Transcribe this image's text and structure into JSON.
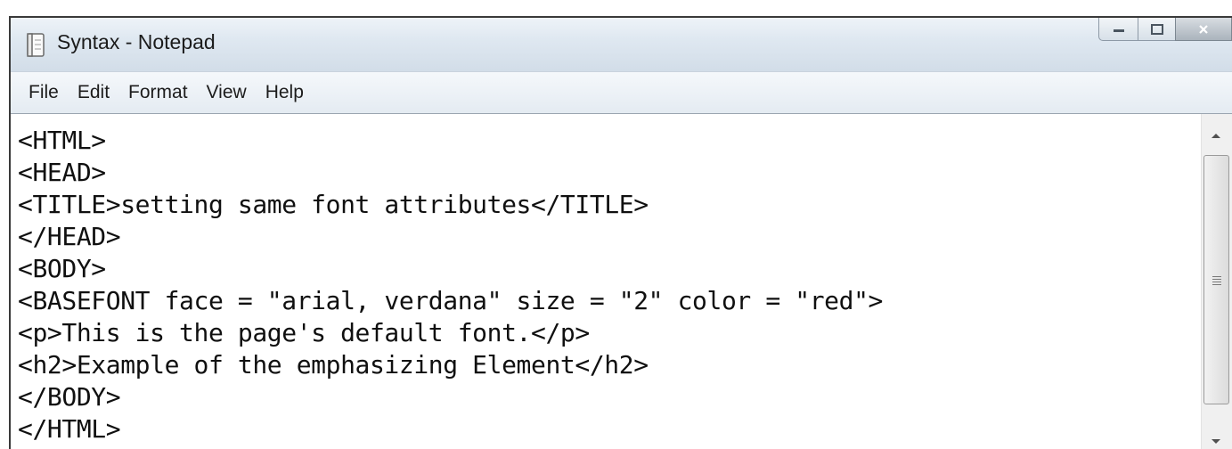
{
  "window": {
    "title": "Syntax - Notepad",
    "icon": "notepad-icon",
    "caption_buttons": [
      "minimize-icon",
      "maximize-icon",
      "close-icon"
    ]
  },
  "menu": {
    "items": [
      "File",
      "Edit",
      "Format",
      "View",
      "Help"
    ]
  },
  "editor": {
    "lines": [
      "<HTML>",
      "<HEAD>",
      "<TITLE>setting same font attributes</TITLE>",
      "</HEAD>",
      "<BODY>",
      "<BASEFONT face = \"arial, verdana\" size = \"2\" color = \"red\">",
      "<p>This is the page's default font.</p>",
      "<h2>Example of the emphasizing Element</h2>",
      "</BODY>",
      "</HTML>"
    ]
  }
}
